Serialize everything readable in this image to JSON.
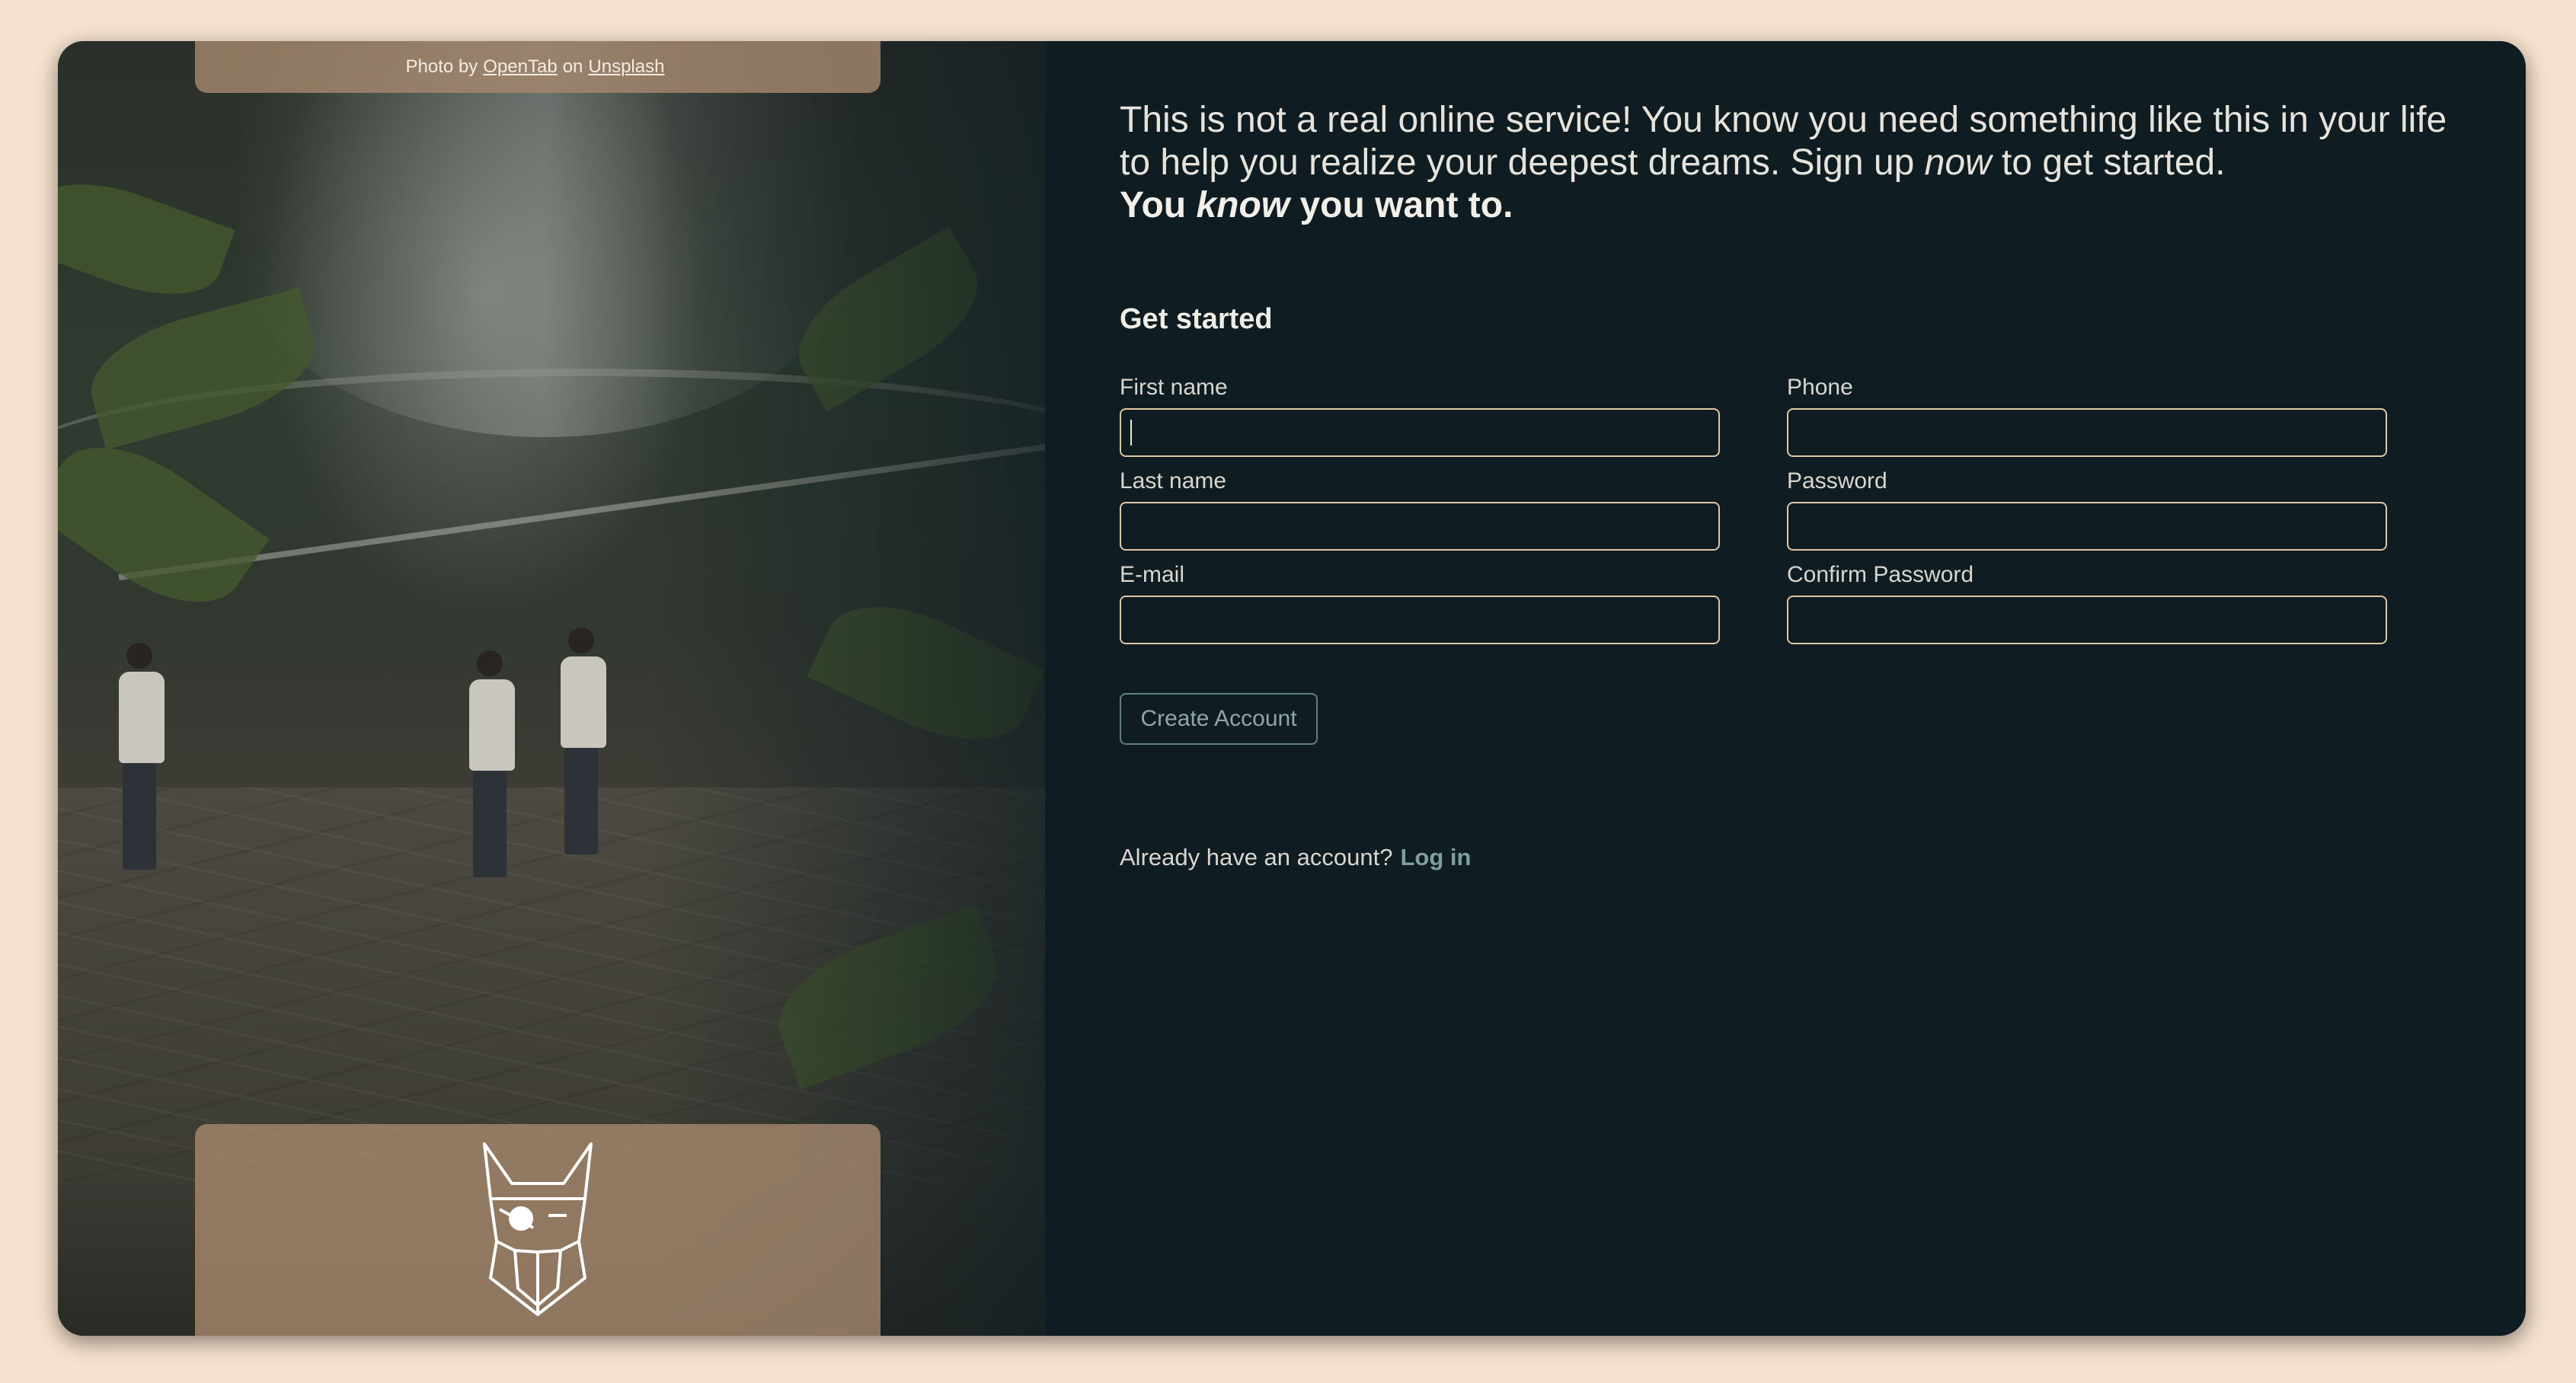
{
  "photo_credit": {
    "prefix": "Photo by",
    "author": "OpenTab",
    "middle": "on",
    "source": "Unsplash"
  },
  "logo": {
    "icon": "viking-head-icon"
  },
  "intro": {
    "line1": "This is not a real online service! You know you need something like this in your life",
    "line2_start": "to help you realize your deepest dreams. Sign up",
    "line2_emphasis": "now",
    "line2_end": "to get started.",
    "line3_start": "You",
    "line3_emphasis": "know",
    "line3_end": "you want to."
  },
  "form": {
    "title": "Get started",
    "fields": {
      "first_name": {
        "label": "First name",
        "value": ""
      },
      "last_name": {
        "label": "Last name",
        "value": ""
      },
      "email": {
        "label": "E-mail",
        "value": ""
      },
      "phone": {
        "label": "Phone",
        "value": ""
      },
      "password": {
        "label": "Password",
        "value": ""
      },
      "confirm_password": {
        "label": "Confirm Password",
        "value": ""
      }
    },
    "submit_label": "Create Account"
  },
  "login": {
    "prompt": "Already have an account?",
    "link_label": "Log in"
  },
  "colors": {
    "page_background": "#f5e1cd",
    "panel_background": "#0f1c21",
    "input_border": "#e0c7a4",
    "button_accent": "#5f7f80",
    "link_accent": "#7fa09a",
    "credit_box": "#a5876c"
  }
}
